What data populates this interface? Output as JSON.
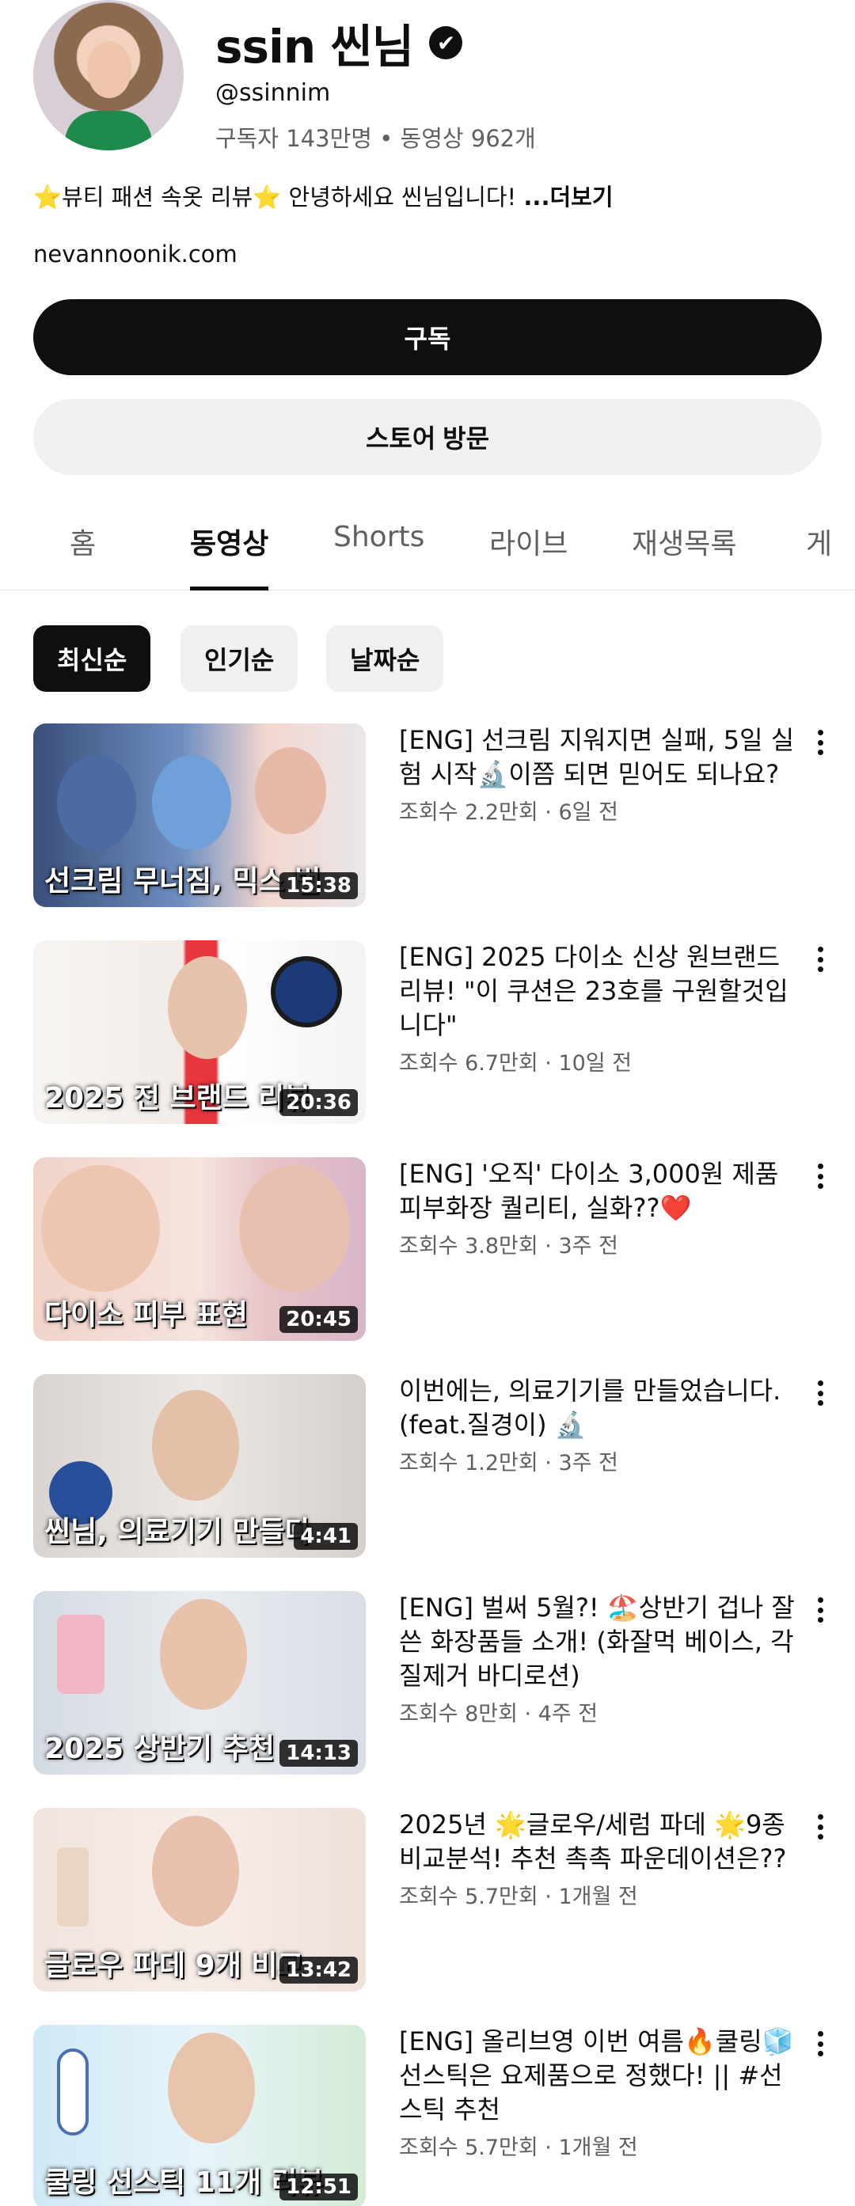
{
  "channel": {
    "name": "ssin 씬님",
    "verified_mark": "✔",
    "handle": "@ssinnim",
    "stats": "구독자 143만명 • 동영상 962개",
    "description": "⭐뷰티 패션 속옷 리뷰⭐ 안녕하세요 씬님입니다! ",
    "more_label": "...더보기",
    "link": "nevannoonik.com"
  },
  "buttons": {
    "subscribe": "구독",
    "store": "스토어 방문"
  },
  "tabs": [
    "홈",
    "동영상",
    "Shorts",
    "라이브",
    "재생목록",
    "게"
  ],
  "active_tab": "동영상",
  "chips": [
    "최신순",
    "인기순",
    "날짜순"
  ],
  "videos": [
    {
      "title": "[ENG] 선크림 지워지면 실패, 5일 실험 시작🔬이쯤 되면 믿어도 되나요?",
      "meta": "조회수 2.2만회 · 6일 전",
      "duration": "15:38",
      "thumb_text": "선크림 무너짐, 믹스 법"
    },
    {
      "title": "[ENG] 2025 다이소 신상 원브랜드 리뷰! \"이 쿠션은 23호를 구원할것입니다\"",
      "meta": "조회수 6.7만회 · 10일 전",
      "duration": "20:36",
      "thumb_text": "2025 전 브랜드 리뷰"
    },
    {
      "title": "[ENG] '오직' 다이소 3,000원 제품 피부화장 퀄리티, 실화??❤️",
      "meta": "조회수 3.8만회 · 3주 전",
      "duration": "20:45",
      "thumb_text": "다이소 피부 표현"
    },
    {
      "title": "이번에는, 의료기기를 만들었습니다. (feat.질경이) 🔬",
      "meta": "조회수 1.2만회 · 3주 전",
      "duration": "4:41",
      "thumb_text": "씬님, 의료기기 만들다"
    },
    {
      "title": "[ENG] 벌써 5월?! 🏖️상반기 겁나 잘쓴 화장품들 소개! (화잘먹 베이스, 각질제거 바디로션)",
      "meta": "조회수 8만회 · 4주 전",
      "duration": "14:13",
      "thumb_text": "2025 상반기 추천"
    },
    {
      "title": "2025년 🌟글로우/세럼 파데 🌟9종 비교분석! 추천 촉촉 파운데이션은??",
      "meta": "조회수 5.7만회 · 1개월 전",
      "duration": "13:42",
      "thumb_text": "글로우 파데 9개 비교"
    },
    {
      "title": "[ENG] 올리브영 이번 여름🔥쿨링🧊선스틱은 요제품으로 정했다! || #선스틱 추천",
      "meta": "조회수 5.7만회 · 1개월 전",
      "duration": "12:51",
      "thumb_text": "쿨링 선스틱 11개 리뷰"
    }
  ],
  "colors": {
    "text": "#0f0f0f",
    "secondary": "#606060",
    "chip_bg": "#f0f0f0"
  }
}
